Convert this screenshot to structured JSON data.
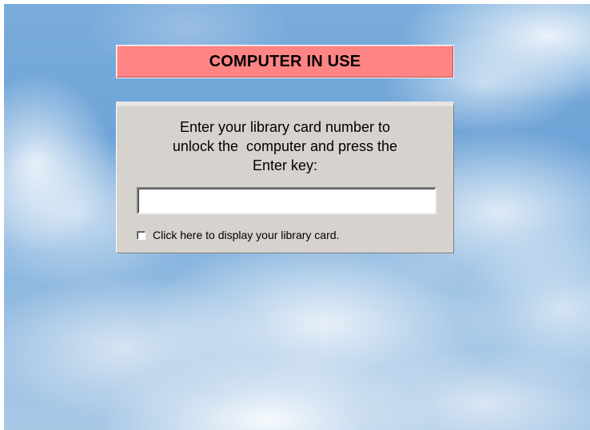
{
  "lock_screen": {
    "banner": {
      "text": "COMPUTER IN USE",
      "color": "#ff8585"
    },
    "panel": {
      "prompt_lines": [
        "Enter your library card number to",
        "unlock the  computer and press the",
        "Enter key:"
      ],
      "card_input": {
        "value": "",
        "placeholder": ""
      },
      "show_card_checkbox": {
        "checked": false,
        "label": "Click here to display your library card."
      },
      "background_color": "#d6d3ce"
    },
    "background": "sky-clouds"
  }
}
